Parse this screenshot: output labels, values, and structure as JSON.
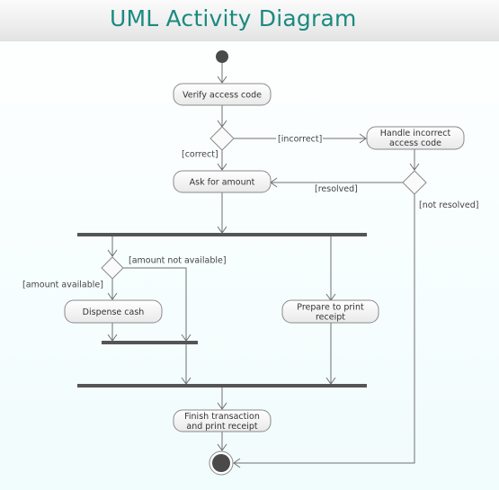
{
  "header": {
    "title": "UML Activity Diagram"
  },
  "colors": {
    "title": "#1b8a7f",
    "bar": "#555555",
    "node_fill": "#4a4a4a",
    "edge": "#707070"
  },
  "nodes": {
    "verify": {
      "label_lines": [
        "Verify access code"
      ]
    },
    "handle": {
      "label_lines": [
        "Handle incorrect",
        "access code"
      ]
    },
    "ask": {
      "label_lines": [
        "Ask for amount"
      ]
    },
    "dispense": {
      "label_lines": [
        "Dispense cash"
      ]
    },
    "prepare": {
      "label_lines": [
        "Prepare to print",
        "receipt"
      ]
    },
    "finish": {
      "label_lines": [
        "Finish transaction",
        "and print receipt"
      ]
    }
  },
  "guards": {
    "incorrect": "[incorrect]",
    "correct": "[correct]",
    "resolved": "[resolved]",
    "not_resolved": "[not resolved]",
    "amount_not_available": "[amount not available]",
    "amount_available": "[amount available]"
  }
}
